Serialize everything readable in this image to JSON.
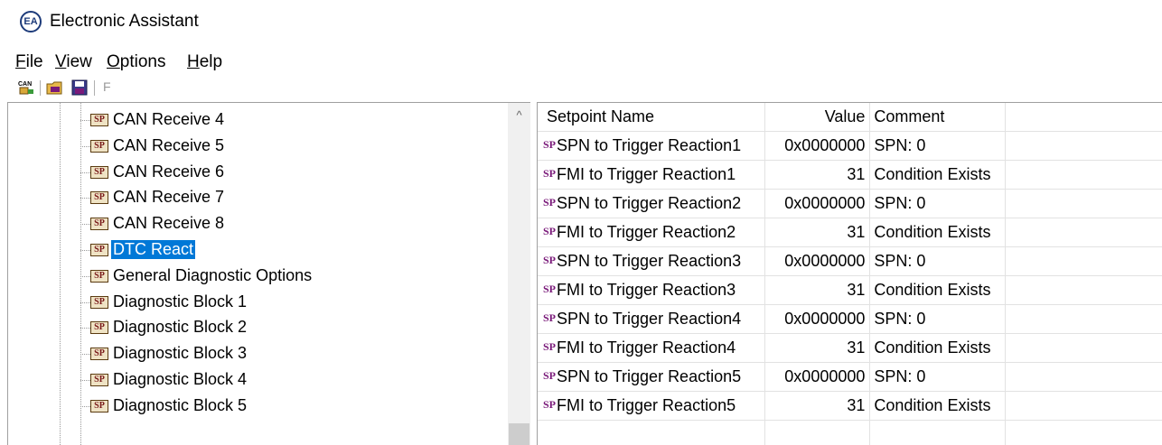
{
  "window": {
    "title": "Electronic Assistant",
    "icon": "ea-logo-icon"
  },
  "menu": [
    {
      "label": "File",
      "accel": "F",
      "rest": "ile"
    },
    {
      "label": "View",
      "accel": "V",
      "rest": "iew"
    },
    {
      "label": "Options",
      "accel": "O",
      "rest": "ptions"
    },
    {
      "label": "Help",
      "accel": "H",
      "rest": "elp"
    }
  ],
  "toolbar": {
    "buttons": [
      "can-connect-icon",
      "open-setpoint-file-icon",
      "save-setpoint-file-icon"
    ],
    "f_label": "F"
  },
  "tree": {
    "icon_label": "SP",
    "items": [
      {
        "label": "CAN Receive 4",
        "selected": false
      },
      {
        "label": "CAN Receive 5",
        "selected": false
      },
      {
        "label": "CAN Receive 6",
        "selected": false
      },
      {
        "label": "CAN Receive 7",
        "selected": false
      },
      {
        "label": "CAN Receive 8",
        "selected": false
      },
      {
        "label": "DTC React",
        "selected": true
      },
      {
        "label": "General Diagnostic Options",
        "selected": false
      },
      {
        "label": "Diagnostic Block 1",
        "selected": false
      },
      {
        "label": "Diagnostic Block 2",
        "selected": false
      },
      {
        "label": "Diagnostic Block 3",
        "selected": false
      },
      {
        "label": "Diagnostic Block 4",
        "selected": false
      },
      {
        "label": "Diagnostic Block 5",
        "selected": false
      }
    ],
    "scroll_up_glyph": "^"
  },
  "grid": {
    "sp_tag": "SP",
    "columns": {
      "name": "Setpoint Name",
      "value": "Value",
      "comment": "Comment"
    },
    "rows": [
      {
        "name": "SPN to Trigger Reaction1",
        "value": "0x0000000",
        "comment": "SPN: 0"
      },
      {
        "name": "FMI to Trigger Reaction1",
        "value": "31",
        "comment": "Condition Exists"
      },
      {
        "name": "SPN to Trigger Reaction2",
        "value": "0x0000000",
        "comment": "SPN: 0"
      },
      {
        "name": "FMI to Trigger Reaction2",
        "value": "31",
        "comment": "Condition Exists"
      },
      {
        "name": "SPN to Trigger Reaction3",
        "value": "0x0000000",
        "comment": "SPN: 0"
      },
      {
        "name": "FMI to Trigger Reaction3",
        "value": "31",
        "comment": "Condition Exists"
      },
      {
        "name": "SPN to Trigger Reaction4",
        "value": "0x0000000",
        "comment": "SPN: 0"
      },
      {
        "name": "FMI to Trigger Reaction4",
        "value": "31",
        "comment": "Condition Exists"
      },
      {
        "name": "SPN to Trigger Reaction5",
        "value": "0x0000000",
        "comment": "SPN: 0"
      },
      {
        "name": "FMI to Trigger Reaction5",
        "value": "31",
        "comment": "Condition Exists"
      }
    ]
  },
  "colors": {
    "selection": "#0078d7",
    "sp_tag": "#7a1a7a",
    "sp_icon_text": "#7a1a1a"
  }
}
